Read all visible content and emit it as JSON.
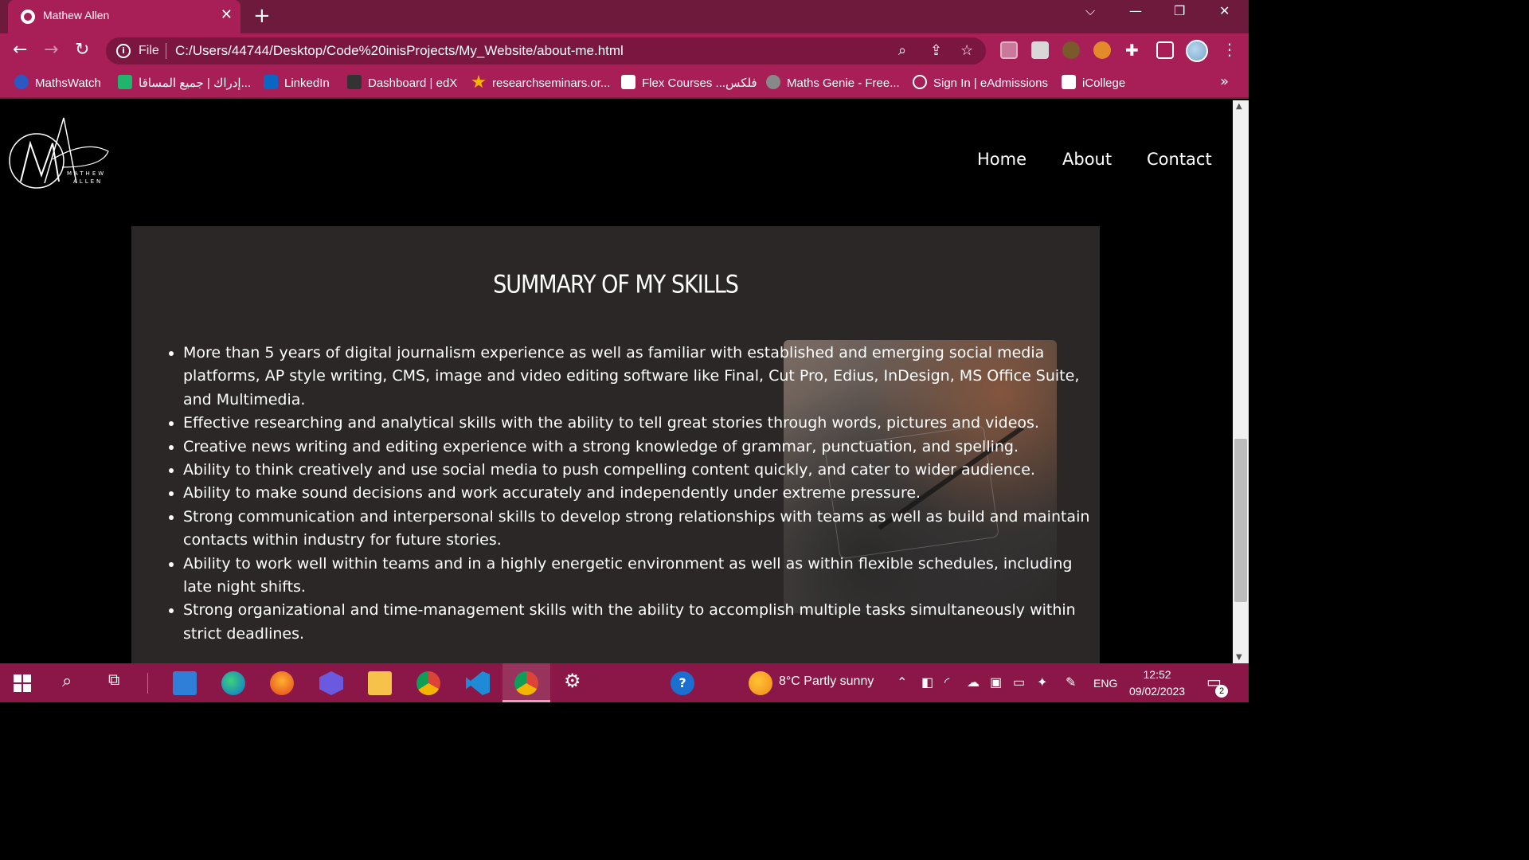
{
  "browser": {
    "tab_title": "Mathew Allen",
    "tab_close": "✕",
    "new_tab": "+",
    "window_controls": {
      "dropdown": "⌵",
      "minimize": "—",
      "restore": "❐",
      "close": "✕"
    },
    "file_label": "File",
    "url": "C:/Users/44744/Desktop/Code%20inisProjects/My_Website/about-me.html",
    "bookmarks": [
      {
        "label": "MathsWatch",
        "icon": "mathswatch-icon",
        "color": "#2b59c3"
      },
      {
        "label": "إدراك | جميع المساقا...",
        "icon": "edraak-icon",
        "color": "#1fb56b"
      },
      {
        "label": "LinkedIn",
        "icon": "linkedin-icon",
        "color": "#0a66c2"
      },
      {
        "label": "Dashboard | edX",
        "icon": "edx-icon",
        "color": "#333333"
      },
      {
        "label": "researchseminars.or...",
        "icon": "star-icon",
        "color": "#f4b400"
      },
      {
        "label": "Flex Courses ...فلكس",
        "icon": "flex-icon",
        "color": "#ffffff"
      },
      {
        "label": "Maths Genie - Free...",
        "icon": "mathsgenie-icon",
        "color": "#888888"
      },
      {
        "label": "Sign In | eAdmissions",
        "icon": "eadmissions-icon",
        "color": "#ffffff"
      },
      {
        "label": "iCollege",
        "icon": "icollege-icon",
        "color": "#ffffff"
      }
    ],
    "more": "»"
  },
  "site": {
    "logo_text": "MATHEW ALLEN",
    "logo_top": "MATHEW",
    "logo_bottom": "ALLEN",
    "nav": [
      "Home",
      "About",
      "Contact"
    ],
    "section_title": "SUMMARY OF MY SKILLS",
    "skills": [
      "More than 5 years of digital journalism experience as well as familiar with established and emerging social media platforms, AP style writing, CMS, image and video editing software like Final, Cut Pro, Edius, InDesign, MS Office Suite, and Multimedia.",
      "Effective researching and analytical skills with the ability to tell great stories through words, pictures and videos.",
      "Creative news writing and editing experience with a strong knowledge of grammar, punctuation, and spelling.",
      "Ability to think creatively and use social media to push compelling content quickly, and cater to wider audience.",
      "Ability to make sound decisions and work accurately and independently under extreme pressure.",
      "Strong communication and interpersonal skills to develop strong relationships with teams as well as build and maintain contacts within industry for future stories.",
      "Ability to work well within teams and in a highly energetic environment as well as within flexible schedules, including late night shifts.",
      "Strong organizational and time-management skills with the ability to accomplish multiple tasks simultaneously within strict deadlines."
    ]
  },
  "taskbar": {
    "weather": "8°C  Partly sunny",
    "language": "ENG",
    "time": "12:52",
    "date": "09/02/2023",
    "notifications": "2"
  }
}
